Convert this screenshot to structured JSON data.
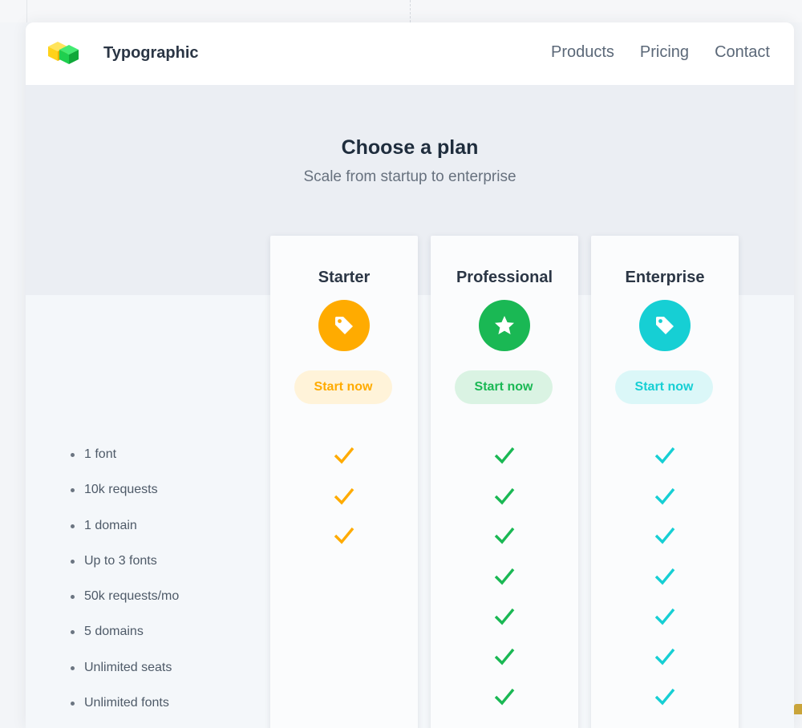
{
  "navbar": {
    "brand": "Typographic",
    "links": [
      "Products",
      "Pricing",
      "Contact"
    ]
  },
  "hero": {
    "title": "Choose a plan",
    "subtitle": "Scale from startup to enterprise"
  },
  "plans": [
    {
      "name": "Starter",
      "cta": "Start now",
      "icon": "tag-icon",
      "color": "#ffab00",
      "button_bg": "#fff3d9",
      "checks": [
        true,
        true,
        true,
        false,
        false,
        false,
        false,
        false
      ]
    },
    {
      "name": "Professional",
      "cta": "Start now",
      "icon": "star-icon",
      "color": "#1ab854",
      "button_bg": "#daf3e3",
      "checks": [
        true,
        true,
        true,
        true,
        true,
        true,
        true,
        true
      ]
    },
    {
      "name": "Enterprise",
      "cta": "Start now",
      "icon": "tag-icon",
      "color": "#16cfd4",
      "button_bg": "#dbf7f8",
      "checks": [
        true,
        true,
        true,
        true,
        true,
        true,
        true,
        true
      ]
    }
  ],
  "features": [
    "1 font",
    "10k requests",
    "1 domain",
    "Up to 3 fonts",
    "50k requests/mo",
    "5 domains",
    "Unlimited seats",
    "Unlimited fonts"
  ],
  "colors": {
    "accent_text": "#1f2d3d",
    "muted_text": "#67717e",
    "hero_bg": "#ebeef3"
  }
}
